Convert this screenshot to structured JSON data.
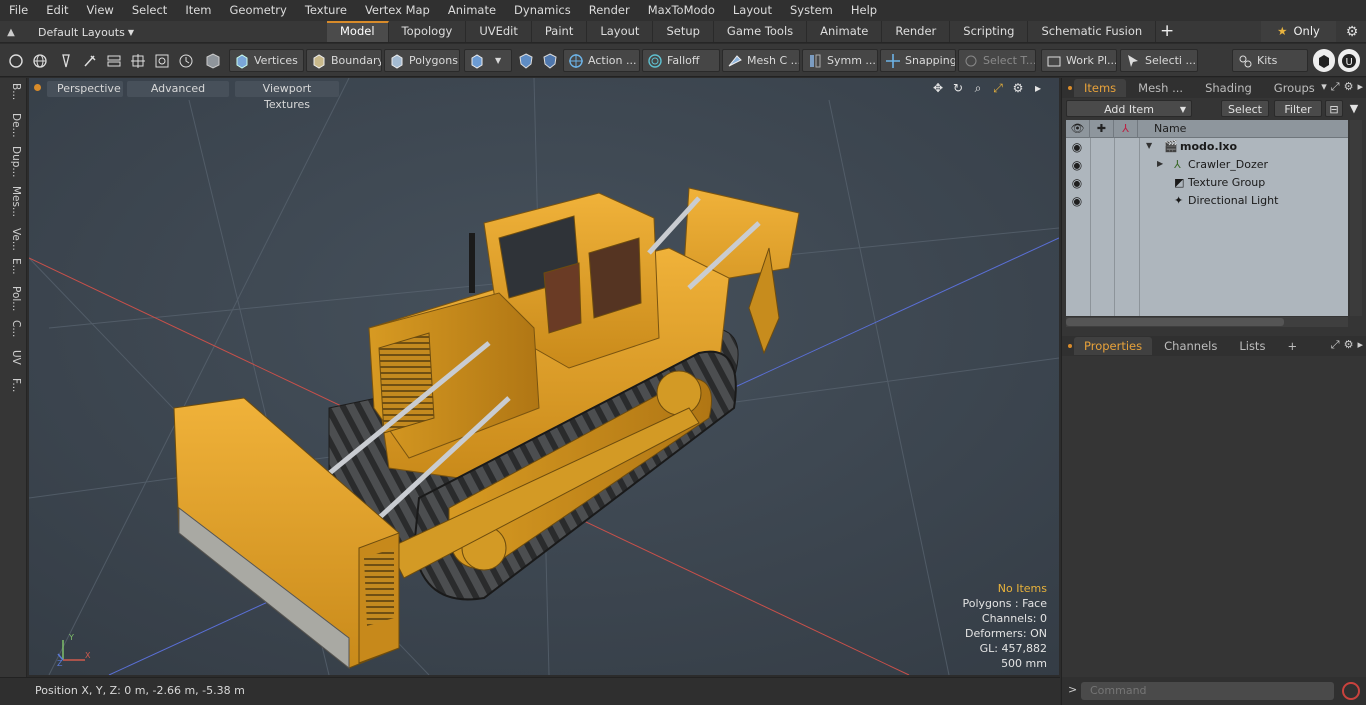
{
  "menu": [
    "File",
    "Edit",
    "View",
    "Select",
    "Item",
    "Geometry",
    "Texture",
    "Vertex Map",
    "Animate",
    "Dynamics",
    "Render",
    "MaxToModo",
    "Layout",
    "System",
    "Help"
  ],
  "layout_selector": "Default Layouts",
  "tabs": [
    {
      "label": "Model",
      "active": true
    },
    {
      "label": "Topology"
    },
    {
      "label": "UVEdit"
    },
    {
      "label": "Paint"
    },
    {
      "label": "Layout"
    },
    {
      "label": "Setup"
    },
    {
      "label": "Game Tools"
    },
    {
      "label": "Animate"
    },
    {
      "label": "Render"
    },
    {
      "label": "Scripting"
    },
    {
      "label": "Schematic Fusion"
    }
  ],
  "only_button": "Only",
  "toolbar": {
    "vertices": "Vertices",
    "boundary": "Boundary",
    "polygons": "Polygons",
    "action": "Action ...",
    "falloff": "Falloff",
    "mesh": "Mesh C ...",
    "symm": "Symm ...",
    "snapping": "Snapping",
    "select_t": "Select T...",
    "work_pl": "Work Pl...",
    "selecti": "Selecti ...",
    "kits": "Kits"
  },
  "left_tabs": [
    "B...",
    "De...",
    "Dup...",
    "Mes...",
    "Ve...",
    "E...",
    "Pol...",
    "C...",
    "UV",
    "F..."
  ],
  "viewport": {
    "perspective": "Perspective",
    "advanced": "Advanced",
    "textures": "Viewport Textures",
    "stats": {
      "no_items": "No Items",
      "polygons": "Polygons : Face",
      "channels": "Channels: 0",
      "deformers": "Deformers: ON",
      "gl": "GL: 457,882",
      "scale": "500 mm"
    }
  },
  "status": "Position X, Y, Z:   0 m, -2.66 m, -5.38 m",
  "panel": {
    "tabs": [
      "Items",
      "Mesh ...",
      "Shading",
      "Groups"
    ],
    "add_item": "Add Item",
    "select": "Select",
    "filter": "Filter",
    "name_header": "Name",
    "items": [
      {
        "label": "modo.lxo",
        "bold": true
      },
      {
        "label": "Crawler_Dozer"
      },
      {
        "label": "Texture Group"
      },
      {
        "label": "Directional Light"
      }
    ],
    "lower_tabs": [
      "Properties",
      "Channels",
      "Lists"
    ],
    "command_placeholder": "Command"
  },
  "colors": {
    "accent": "#d88b2a",
    "machine": "#e0a128",
    "viewport_bg": "#3b4550"
  }
}
